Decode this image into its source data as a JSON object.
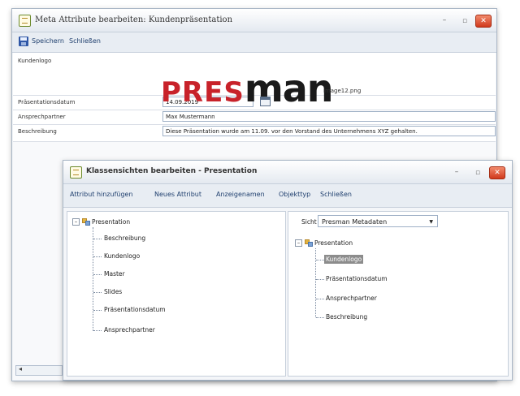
{
  "main_window": {
    "title": "Meta Attribute bearbeiten: Kundenpräsentation",
    "toolbar": {
      "save_label": "Speichern",
      "close_label": "Schließen"
    },
    "rows": {
      "logo_label": "Kundenlogo",
      "logo_text_red": "PRES",
      "logo_text_black": "man",
      "logo_file": "image12.png",
      "date_label": "Präsentationsdatum",
      "date_value": "14.09.2019",
      "contact_label": "Ansprechpartner",
      "contact_value": "Max Mustermann",
      "description_label": "Beschreibung",
      "description_value": "Diese Präsentation wurde am 11.09. vor den Vorstand des Unternehmens XYZ gehalten."
    },
    "scroll_left": "◂"
  },
  "dialog": {
    "title": "Klassensichten bearbeiten - Presentation",
    "toolbar": [
      "Attribut hinzufügen",
      "Neues Attribut",
      "Anzeigenamen",
      "Objekttyp",
      "Schließen"
    ],
    "left_tree": {
      "root": "Presentation",
      "children": [
        "Beschreibung",
        "Kundenlogo",
        "Master",
        "Slides",
        "Präsentationsdatum",
        "Ansprechpartner"
      ]
    },
    "right_panel": {
      "view_label": "Sicht",
      "view_value": "Presman Metadaten",
      "root": "Presentation",
      "children": [
        "Kundenlogo",
        "Präsentationsdatum",
        "Ansprechpartner",
        "Beschreibung"
      ],
      "selected": "Kundenlogo"
    }
  },
  "window_buttons": {
    "minimize": "–",
    "maximize": "▫",
    "close": "✕"
  },
  "tree_expander": "–"
}
